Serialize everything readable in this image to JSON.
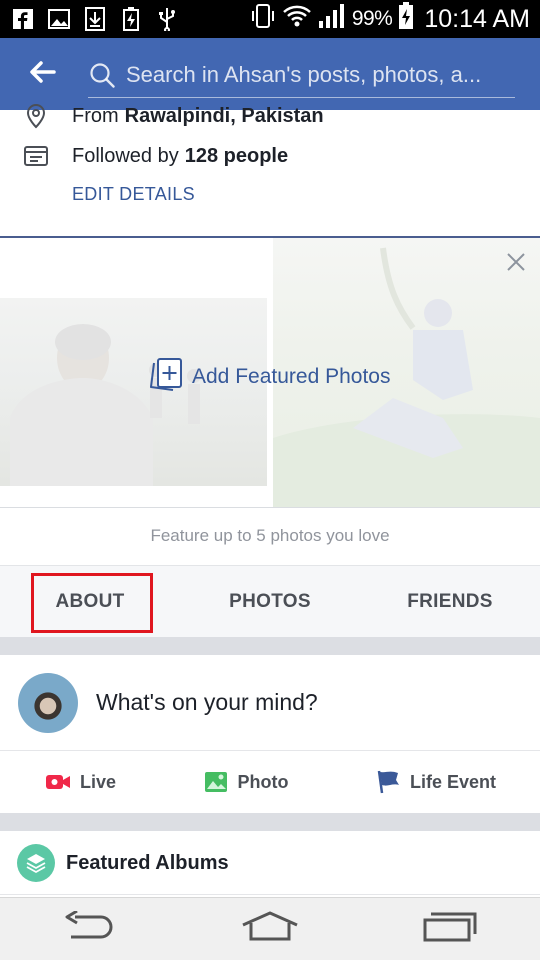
{
  "status_bar": {
    "battery_percent": "99%",
    "time": "10:14 AM",
    "left_icons": [
      "facebook-icon",
      "image-icon",
      "download-icon",
      "battery-charging-icon",
      "usb-icon"
    ],
    "right_icons": [
      "vibrate-icon",
      "wifi-icon",
      "signal-icon",
      "battery-icon"
    ]
  },
  "app_bar": {
    "back_icon": "arrow-left-icon",
    "search_placeholder": "Search in Ahsan's posts, photos, a..."
  },
  "details": {
    "from_prefix": "From",
    "from_place": "Rawalpindi, Pakistan",
    "followed_prefix": "Followed by",
    "followed_count": "128 people",
    "edit_label": "EDIT DETAILS"
  },
  "featured": {
    "add_label": "Add Featured Photos",
    "caption": "Feature up to 5 photos you love"
  },
  "tabs": [
    {
      "label": "ABOUT"
    },
    {
      "label": "PHOTOS"
    },
    {
      "label": "FRIENDS"
    }
  ],
  "composer": {
    "prompt": "What's on your mind?"
  },
  "actions": [
    {
      "label": "Live",
      "icon": "live-video-icon",
      "color": "#f02849"
    },
    {
      "label": "Photo",
      "icon": "photo-icon",
      "color": "#45bd62"
    },
    {
      "label": "Life Event",
      "icon": "flag-icon",
      "color": "#3b5998"
    }
  ],
  "albums": {
    "title": "Featured Albums",
    "icon_color": "#5bc8a5"
  },
  "colors": {
    "brand_blue": "#4267b2",
    "link_blue": "#365899",
    "highlight_red": "#e0161f"
  }
}
